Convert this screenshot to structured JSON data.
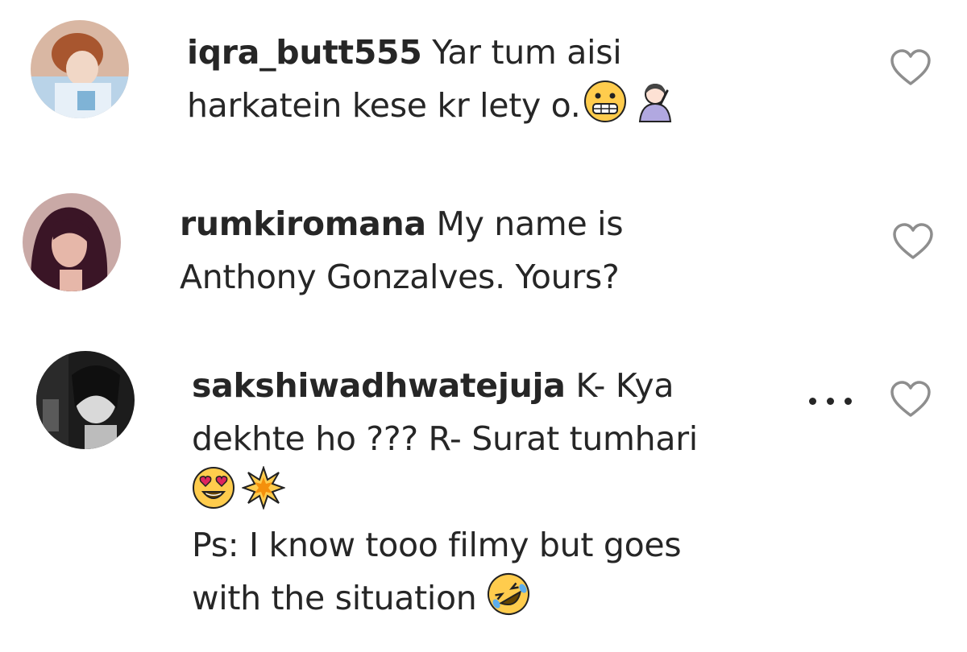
{
  "comments": [
    {
      "username": "iqra_butt555",
      "line1": "Yar tum aisi",
      "line2": "harkatein kese kr lety o.",
      "emojis": [
        "grinning-face-emoji",
        "woman-raising-hand-emoji"
      ]
    },
    {
      "username": "rumkiromana",
      "line1": "My name is",
      "line2": "Anthony Gonzalves. Yours?"
    },
    {
      "username": "sakshiwadhwatejuja",
      "line1": "K- Kya",
      "line2": "dekhte ho ??? R- Surat tumhari",
      "emojis": [
        "heart-eyes-emoji",
        "collision-emoji"
      ],
      "line4": "Ps: I know tooo filmy but goes",
      "line5": "with the situation",
      "end_emoji": "rolling-laughing-emoji"
    }
  ],
  "icons": {
    "like": "heart-outline-icon",
    "options": "more-options-icon"
  },
  "colors": {
    "text": "#262626",
    "heart_stroke": "#8e8e8e",
    "emoji_yellow": "#ffcc4d"
  }
}
